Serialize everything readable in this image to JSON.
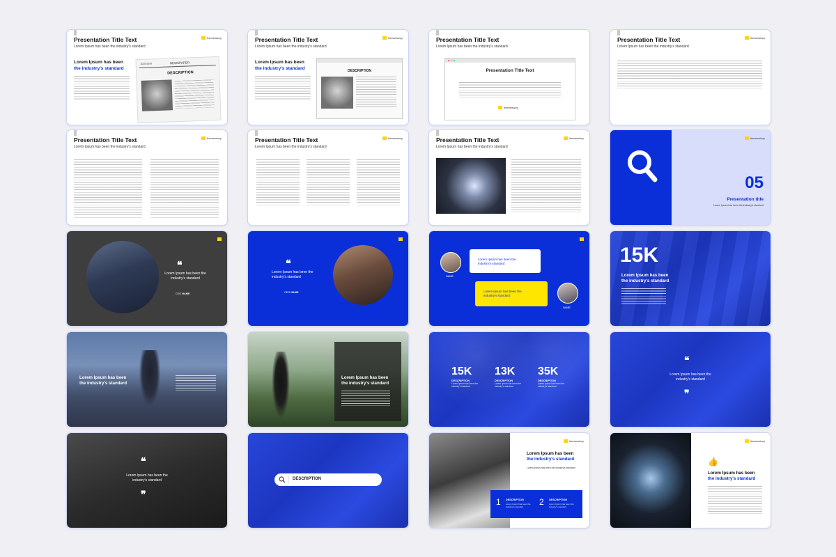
{
  "common": {
    "title": "Presentation Title Text",
    "subtitle": "Lorem Ipsum has been the industry's standard",
    "logo_text": "themewizzy",
    "head_black": "Lorem Ipsum has been",
    "head_blue": "the industry's standard",
    "quote_text": "Lorem Ipsum has been the industry's standard",
    "quote_mark": "❝❞"
  },
  "s1": {
    "newspaper": "NEWSPAPER",
    "date": "2025/2026",
    "description": "DESCRIPTION"
  },
  "s2": {
    "description": "DESCRIPTION"
  },
  "s3": {
    "inner_title": "Presentation Title Text"
  },
  "s8": {
    "number": "05",
    "title": "Presentation title",
    "desc": "Lorem Ipsum has been the industry's standard"
  },
  "s9": {
    "ceo": "CEO",
    "name": "NAME"
  },
  "s10": {
    "ceo": "CEO",
    "name": "NAME"
  },
  "s11": {
    "name1": "NAME",
    "name2": "NAME"
  },
  "s12": {
    "big": "15K"
  },
  "s15": {
    "stats": [
      {
        "value": "15K",
        "label": "DESCRIPTION",
        "text": "Lorem Ipsum has been the industry's standard"
      },
      {
        "value": "13K",
        "label": "DESCRIPTION",
        "text": "Lorem Ipsum has been the industry's standard"
      },
      {
        "value": "35K",
        "label": "DESCRIPTION",
        "text": "Lorem Ipsum has been the industry's standard"
      }
    ]
  },
  "s18": {
    "search_label": "DESCRIPTION"
  },
  "s19": {
    "desc": "Lorem Ipsum has been the industry's standard",
    "items": [
      {
        "num": "1",
        "label": "DESCRIPTION",
        "text": "Lorem Ipsum has been the industry's standard"
      },
      {
        "num": "2",
        "label": "DESCRIPTION",
        "text": "Lorem Ipsum has been the industry's standard"
      }
    ]
  },
  "colors": {
    "blue": "#0a2fd8",
    "yellow": "#ffe600",
    "dark": "#3e3e3e"
  }
}
